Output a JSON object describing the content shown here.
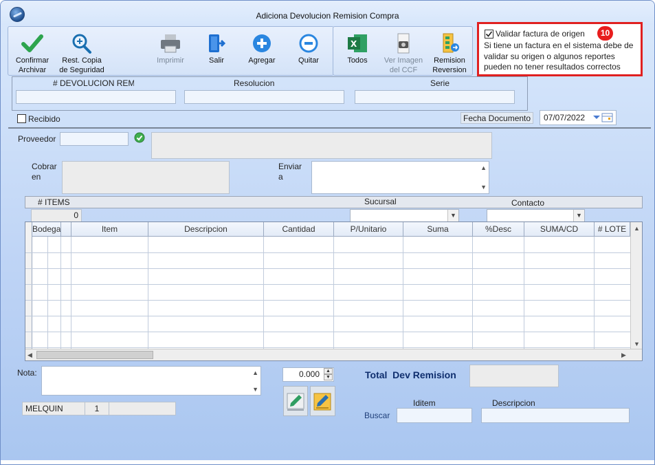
{
  "window": {
    "title": "Adiciona Devolucion Remision Compra"
  },
  "toolbar": {
    "confirmar": "Confirmar\nArchivar",
    "rest_copia": "Rest. Copia\nde Seguridad",
    "imprimir": "Imprimir",
    "salir": "Salir",
    "agregar": "Agregar",
    "quitar": "Quitar",
    "todos": "Todos",
    "ver_imagen": "Ver Imagen\ndel CCF",
    "remision_reversion": "Remision\nReversion"
  },
  "validar": {
    "checked": true,
    "label": "Validar factura de origen",
    "badge": "10",
    "note": "Si tiene un factura en el sistema debe de validar su origen o algunos reportes pueden no tener resultados correctos"
  },
  "header_panel": {
    "devolucion_label": "# DEVOLUCION REM",
    "resolucion_label": "Resolucion",
    "serie_label": "Serie"
  },
  "recibido": {
    "label": "Recibido",
    "checked": false
  },
  "fecha": {
    "label": "Fecha Documento",
    "value": "07/07/2022"
  },
  "proveedor": {
    "label": "Proveedor"
  },
  "cobrar": {
    "label": "Cobrar\nen"
  },
  "enviar": {
    "label": "Enviar\na"
  },
  "items_bar": {
    "items_label": "# ITEMS",
    "items_value": "0",
    "sucursal_label": "Sucursal",
    "contacto_label": "Contacto"
  },
  "grid": {
    "columns": [
      "Bodega",
      "Item",
      "Descripcion",
      "Cantidad",
      "P/Unitario",
      "Suma",
      "%Desc",
      "SUMA/CD",
      "# LOTE"
    ]
  },
  "nota": {
    "label": "Nota:"
  },
  "footer": {
    "quantity": "0.000",
    "total_label": "Total  Dev Remision",
    "user": "MELQUIN",
    "user_num": "1",
    "iditem_label": "Iditem",
    "descripcion_label": "Descripcion",
    "buscar_label": "Buscar"
  },
  "colors": {
    "accent_red": "#e02020",
    "excel_green": "#1d7a45",
    "blue_icon": "#1e7fd6"
  }
}
